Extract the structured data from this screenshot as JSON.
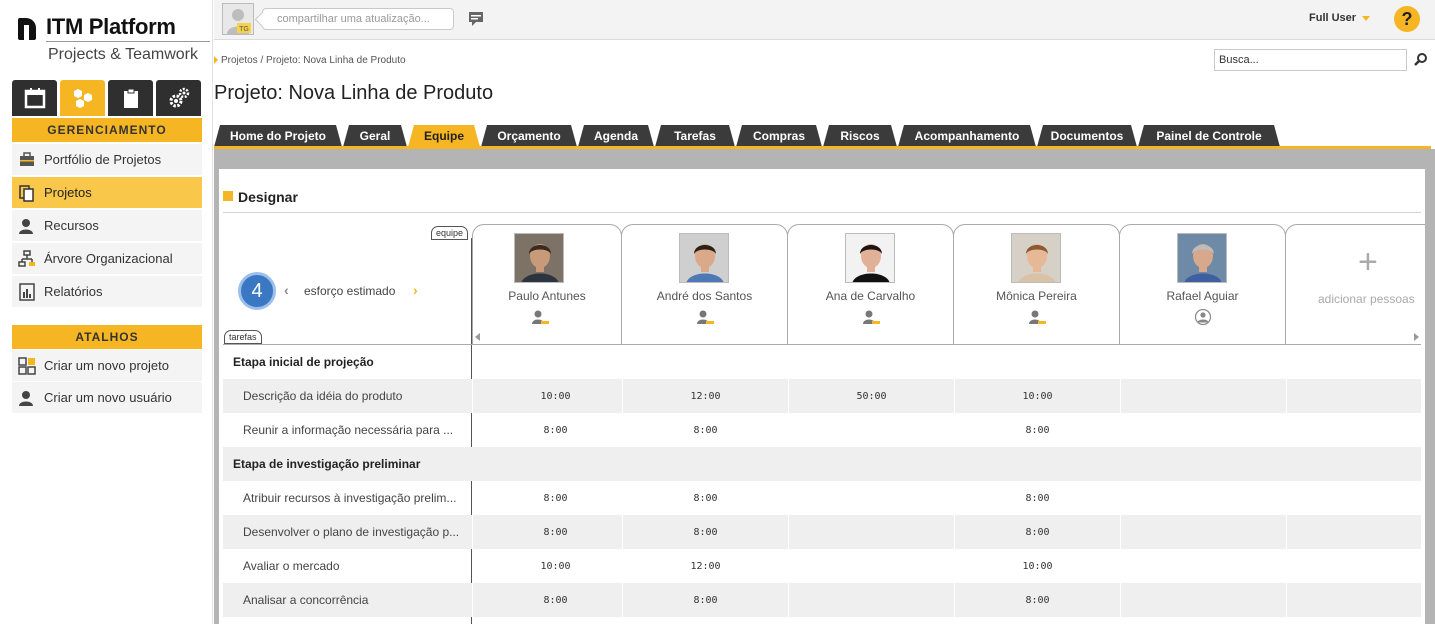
{
  "brand": {
    "name": "ITM Platform",
    "tagline": "Projects & Teamwork"
  },
  "module_tabs": [
    {
      "name": "calendar-icon",
      "active": false
    },
    {
      "name": "cubes-icon",
      "active": true
    },
    {
      "name": "clipboard-icon",
      "active": false
    },
    {
      "name": "gears-icon",
      "active": false
    }
  ],
  "sidebar": {
    "management_title": "GERENCIAMENTO",
    "items": [
      {
        "label": "Portfólio de Projetos",
        "icon": "briefcase-icon",
        "active": false
      },
      {
        "label": "Projetos",
        "icon": "documents-icon",
        "active": true
      },
      {
        "label": "Recursos",
        "icon": "user-icon",
        "active": false
      },
      {
        "label": "Árvore Organizacional",
        "icon": "org-tree-icon",
        "active": false
      },
      {
        "label": "Relatórios",
        "icon": "report-icon",
        "active": false
      }
    ],
    "shortcuts_title": "ATALHOS",
    "shortcuts": [
      {
        "label": "Criar um novo projeto",
        "icon": "new-project-icon"
      },
      {
        "label": "Criar um novo usuário",
        "icon": "new-user-icon"
      }
    ]
  },
  "topbar": {
    "avatar_initials": "TG",
    "status_placeholder": "compartilhar uma atualização...",
    "user_name": "Full User",
    "help_label": "?"
  },
  "breadcrumb": "Projetos / Projeto: Nova Linha de Produto",
  "search": {
    "value": "Busca..."
  },
  "page_title": "Projeto: Nova Linha de Produto",
  "tabs": [
    {
      "label": "Home do Projeto",
      "active": false
    },
    {
      "label": "Geral",
      "active": false
    },
    {
      "label": "Equipe",
      "active": true
    },
    {
      "label": "Orçamento",
      "active": false
    },
    {
      "label": "Agenda",
      "active": false
    },
    {
      "label": "Tarefas",
      "active": false
    },
    {
      "label": "Compras",
      "active": false
    },
    {
      "label": "Riscos",
      "active": false
    },
    {
      "label": "Acompanhamento",
      "active": false
    },
    {
      "label": "Documentos",
      "active": false
    },
    {
      "label": "Painel de Controle",
      "active": false
    }
  ],
  "assign": {
    "title": "Designar",
    "team_label": "equipe",
    "tasks_label": "tarefas",
    "team_count": "4",
    "metric": "esforço estimado",
    "prev_symbol": "‹",
    "next_symbol": "›",
    "add_people": "adicionar pessoas",
    "add_symbol": "+",
    "people": [
      {
        "name": "Paulo Antunes",
        "role_icon": "assigned-user-icon",
        "skin": "#c89a7a",
        "hair": "#3a2a20",
        "shirt": "#2d3440",
        "bg": "#7d7266"
      },
      {
        "name": "André dos Santos",
        "role_icon": "assigned-user-icon",
        "skin": "#d9a98a",
        "hair": "#2b2118",
        "shirt": "#4f79b5",
        "bg": "#cfcfcf"
      },
      {
        "name": "Ana de Carvalho",
        "role_icon": "assigned-user-icon",
        "skin": "#e0b196",
        "hair": "#1e1512",
        "shirt": "#111111",
        "bg": "#f2f2f2"
      },
      {
        "name": "Mônica Pereira",
        "role_icon": "assigned-user-icon",
        "skin": "#e6b896",
        "hair": "#8a5a34",
        "shirt": "#d9c2a5",
        "bg": "#d6d0c6"
      },
      {
        "name": "Rafael Aguiar",
        "role_icon": "unassigned-user-icon",
        "skin": "#d7a88c",
        "hair": "#bdbdbd",
        "shirt": "#3f5fa0",
        "bg": "#6e8aa6"
      }
    ],
    "rows": [
      {
        "type": "phase",
        "label": "Etapa inicial de projeção",
        "values": []
      },
      {
        "type": "task",
        "label": "Descrição da idéia do produto",
        "values": [
          "10:00",
          "12:00",
          "50:00",
          "10:00",
          "",
          ""
        ]
      },
      {
        "type": "task",
        "label": "Reunir a informação necessária para ...",
        "values": [
          "8:00",
          "8:00",
          "",
          "8:00",
          "",
          ""
        ]
      },
      {
        "type": "phase",
        "label": "Etapa de investigação preliminar",
        "values": []
      },
      {
        "type": "task",
        "label": "Atribuir recursos à investigação prelim...",
        "values": [
          "8:00",
          "8:00",
          "",
          "8:00",
          "",
          ""
        ]
      },
      {
        "type": "task",
        "label": "Desenvolver o plano de investigação p...",
        "values": [
          "8:00",
          "8:00",
          "",
          "8:00",
          "",
          ""
        ]
      },
      {
        "type": "task",
        "label": "Avaliar o mercado",
        "values": [
          "10:00",
          "12:00",
          "",
          "10:00",
          "",
          ""
        ]
      },
      {
        "type": "task",
        "label": "Analisar a concorrência",
        "values": [
          "8:00",
          "8:00",
          "",
          "8:00",
          "",
          ""
        ]
      }
    ]
  },
  "colors": {
    "accent": "#f6b623",
    "dark_tab": "#3b3b3b",
    "badge_blue": "#3a78c3"
  }
}
